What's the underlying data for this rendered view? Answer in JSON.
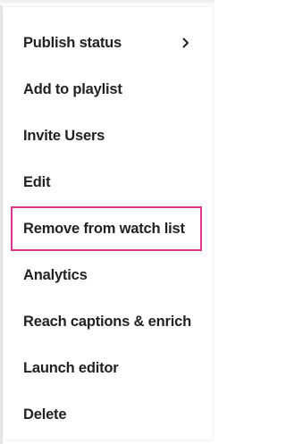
{
  "menu": {
    "highlight_color": "#e0368c",
    "items": [
      {
        "label": "Publish status",
        "has_submenu": true,
        "icon": "chevron-right-icon"
      },
      {
        "label": "Add to playlist"
      },
      {
        "label": "Invite Users"
      },
      {
        "label": "Edit"
      },
      {
        "label": "Remove from watch list",
        "highlighted": true
      },
      {
        "label": "Analytics"
      },
      {
        "label": "Reach captions & enrich"
      },
      {
        "label": "Launch editor"
      },
      {
        "label": "Delete"
      }
    ]
  }
}
